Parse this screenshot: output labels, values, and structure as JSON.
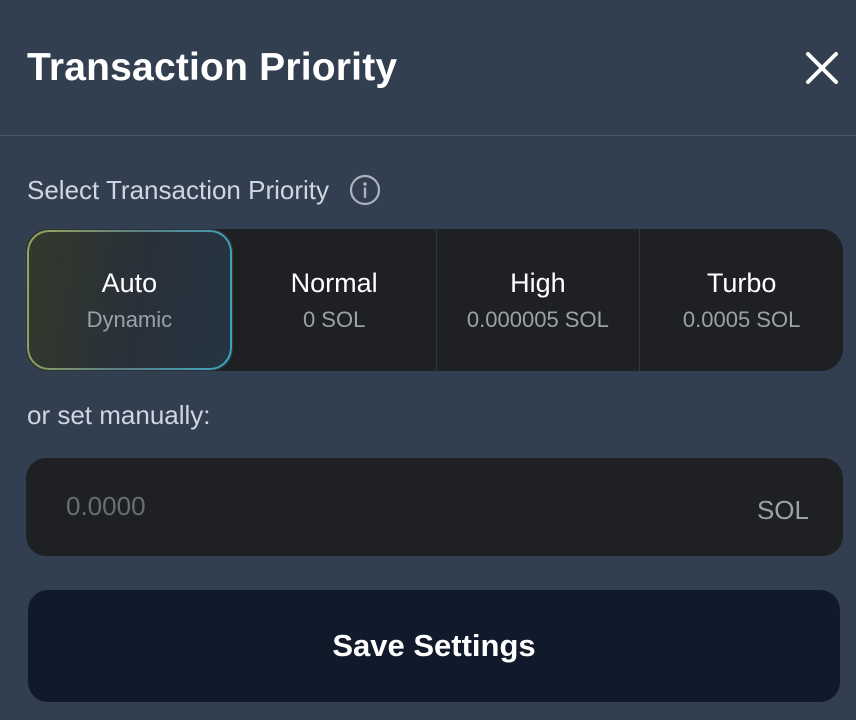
{
  "header": {
    "title": "Transaction Priority",
    "close_icon": "close-icon"
  },
  "priority": {
    "label": "Select Transaction Priority",
    "info_icon": "info-icon",
    "selected": "Auto",
    "options": [
      {
        "name": "Auto",
        "sub": "Dynamic"
      },
      {
        "name": "Normal",
        "sub": "0 SOL"
      },
      {
        "name": "High",
        "sub": "0.000005 SOL"
      },
      {
        "name": "Turbo",
        "sub": "0.0005 SOL"
      }
    ]
  },
  "manual": {
    "label": "or set manually:",
    "value": "",
    "placeholder": "0.0000",
    "unit": "SOL"
  },
  "save": {
    "label": "Save Settings"
  },
  "colors": {
    "background": "#323f50",
    "panel": "#1f2024",
    "save_button": "#111a2a",
    "selected_border_start": "#9aa85a",
    "selected_border_end": "#3aa6c1"
  }
}
